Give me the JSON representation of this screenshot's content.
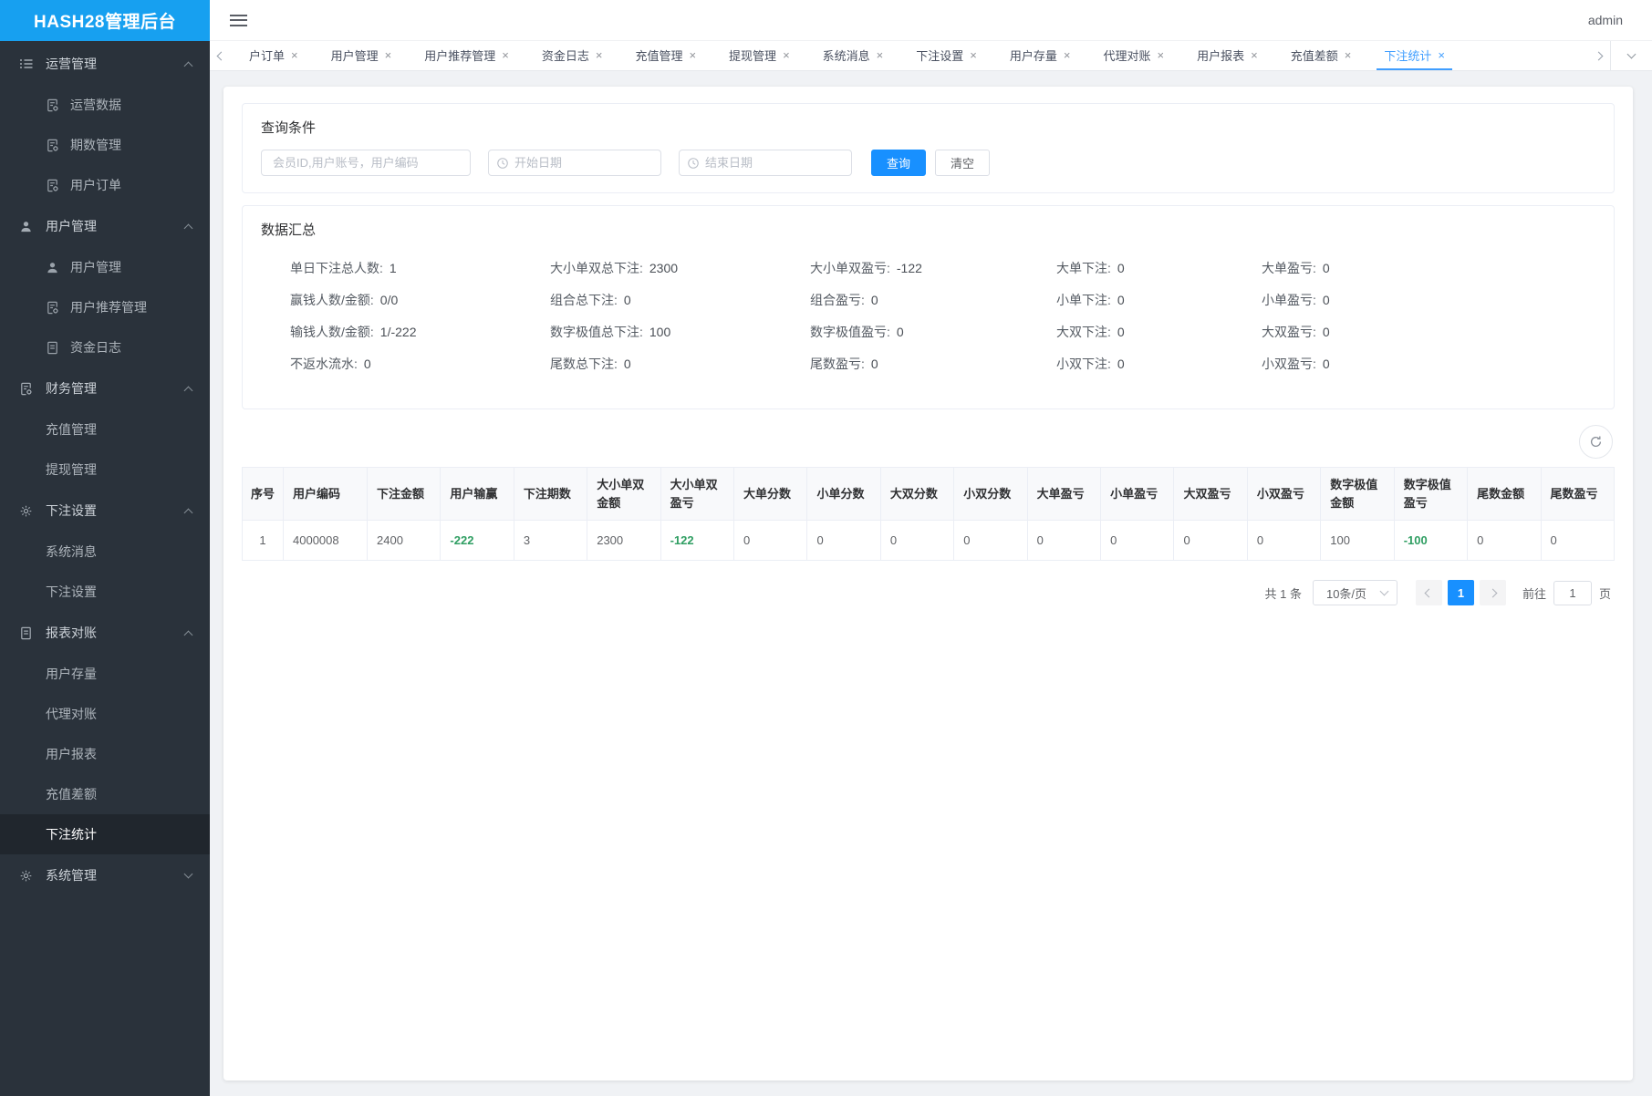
{
  "colors": {
    "brand": "#17a0f0",
    "accent": "#1890ff",
    "tabblue": "#409eff",
    "sidebar": "#2a323b",
    "sidebar_active": "#20262d",
    "green": "#2f9e62",
    "bg": "#f0f2f5"
  },
  "app": {
    "title": "HASH28管理后台",
    "user": "admin"
  },
  "sidebar": {
    "sections": [
      {
        "name": "operations",
        "label": "运营管理",
        "icon": "list-icon",
        "expanded": true,
        "children": [
          {
            "name": "operation-data",
            "label": "运营数据",
            "icon": "doc-gear-icon"
          },
          {
            "name": "period-management",
            "label": "期数管理",
            "icon": "doc-gear-icon"
          },
          {
            "name": "user-orders",
            "label": "用户订单",
            "icon": "doc-gear-icon"
          }
        ]
      },
      {
        "name": "user-management",
        "label": "用户管理",
        "icon": "user-icon",
        "expanded": true,
        "children": [
          {
            "name": "user-management",
            "label": "用户管理",
            "icon": "user-icon"
          },
          {
            "name": "user-referral",
            "label": "用户推荐管理",
            "icon": "doc-gear-icon"
          },
          {
            "name": "fund-logs",
            "label": "资金日志",
            "icon": "doc-icon"
          }
        ]
      },
      {
        "name": "finance",
        "label": "财务管理",
        "icon": "doc-gear-icon",
        "expanded": true,
        "children": [
          {
            "name": "recharge-management",
            "label": "充值管理"
          },
          {
            "name": "withdraw-management",
            "label": "提现管理"
          }
        ]
      },
      {
        "name": "bet-settings",
        "label": "下注设置",
        "icon": "gear-icon",
        "expanded": true,
        "children": [
          {
            "name": "system-messages",
            "label": "系统消息"
          },
          {
            "name": "bet-settings",
            "label": "下注设置"
          }
        ]
      },
      {
        "name": "reports",
        "label": "报表对账",
        "icon": "doc-icon",
        "expanded": true,
        "children": [
          {
            "name": "user-balance",
            "label": "用户存量"
          },
          {
            "name": "agent-reconciliation",
            "label": "代理对账"
          },
          {
            "name": "user-reports",
            "label": "用户报表"
          },
          {
            "name": "recharge-difference",
            "label": "充值差额"
          },
          {
            "name": "bet-statistics",
            "label": "下注统计",
            "active": true
          }
        ]
      },
      {
        "name": "system",
        "label": "系统管理",
        "icon": "gear-icon",
        "expanded": false,
        "children": []
      }
    ]
  },
  "tabs": {
    "items": [
      {
        "name": "user-orders",
        "label": "户订单"
      },
      {
        "name": "user-management",
        "label": "用户管理"
      },
      {
        "name": "user-referral",
        "label": "用户推荐管理"
      },
      {
        "name": "fund-logs",
        "label": "资金日志"
      },
      {
        "name": "recharge-management",
        "label": "充值管理"
      },
      {
        "name": "withdraw-management",
        "label": "提现管理"
      },
      {
        "name": "system-messages",
        "label": "系统消息"
      },
      {
        "name": "bet-settings",
        "label": "下注设置"
      },
      {
        "name": "user-balance",
        "label": "用户存量"
      },
      {
        "name": "agent-reconciliation",
        "label": "代理对账"
      },
      {
        "name": "user-reports",
        "label": "用户报表"
      },
      {
        "name": "recharge-difference",
        "label": "充值差额"
      },
      {
        "name": "bet-statistics",
        "label": "下注统计",
        "active": true
      }
    ]
  },
  "query": {
    "title": "查询条件",
    "keyword_placeholder": "会员ID,用户账号，用户编码",
    "start_placeholder": "开始日期",
    "end_placeholder": "结束日期",
    "search_label": "查询",
    "clear_label": "清空"
  },
  "summary": {
    "title": "数据汇总",
    "rows": [
      [
        {
          "label": "单日下注总人数:",
          "value": "1"
        },
        {
          "label": "大小单双总下注:",
          "value": "2300"
        },
        {
          "label": "大小单双盈亏:",
          "value": "-122"
        },
        {
          "label": "大单下注:",
          "value": "0"
        },
        {
          "label": "大单盈亏:",
          "value": "0"
        }
      ],
      [
        {
          "label": "赢钱人数/金额:",
          "value": "0/0"
        },
        {
          "label": "组合总下注:",
          "value": "0"
        },
        {
          "label": "组合盈亏:",
          "value": "0"
        },
        {
          "label": "小单下注:",
          "value": "0"
        },
        {
          "label": "小单盈亏:",
          "value": "0"
        }
      ],
      [
        {
          "label": "输钱人数/金额:",
          "value": "1/-222"
        },
        {
          "label": "数字极值总下注:",
          "value": "100"
        },
        {
          "label": "数字极值盈亏:",
          "value": "0"
        },
        {
          "label": "大双下注:",
          "value": "0"
        },
        {
          "label": "大双盈亏:",
          "value": "0"
        }
      ],
      [
        {
          "label": "不返水流水:",
          "value": "0"
        },
        {
          "label": "尾数总下注:",
          "value": "0"
        },
        {
          "label": "尾数盈亏:",
          "value": "0"
        },
        {
          "label": "小双下注:",
          "value": "0"
        },
        {
          "label": "小双盈亏:",
          "value": "0"
        }
      ]
    ]
  },
  "table": {
    "columns": [
      {
        "name": "seq",
        "label": "序号"
      },
      {
        "name": "user-code",
        "label": "用户编码"
      },
      {
        "name": "bet-amount",
        "label": "下注金额"
      },
      {
        "name": "user-winloss",
        "label": "用户输赢"
      },
      {
        "name": "bet-periods",
        "label": "下注期数"
      },
      {
        "name": "bigsmall-amount",
        "label": "大小单双金额"
      },
      {
        "name": "bigsmall-pl",
        "label": "大小单双盈亏"
      },
      {
        "name": "big-odd-score",
        "label": "大单分数"
      },
      {
        "name": "small-odd-score",
        "label": "小单分数"
      },
      {
        "name": "big-even-score",
        "label": "大双分数"
      },
      {
        "name": "small-even-score",
        "label": "小双分数"
      },
      {
        "name": "big-odd-pl",
        "label": "大单盈亏"
      },
      {
        "name": "small-odd-pl",
        "label": "小单盈亏"
      },
      {
        "name": "big-even-pl",
        "label": "大双盈亏"
      },
      {
        "name": "small-even-pl",
        "label": "小双盈亏"
      },
      {
        "name": "extreme-amount",
        "label": "数字极值金额"
      },
      {
        "name": "extreme-pl",
        "label": "数字极值盈亏"
      },
      {
        "name": "tail-amount",
        "label": "尾数金额"
      },
      {
        "name": "tail-pl",
        "label": "尾数盈亏"
      }
    ],
    "rows": [
      [
        "1",
        "4000008",
        "2400",
        "-222",
        "3",
        "2300",
        "-122",
        "0",
        "0",
        "0",
        "0",
        "0",
        "0",
        "0",
        "0",
        "100",
        "-100",
        "0",
        "0"
      ]
    ]
  },
  "pagination": {
    "total": "共 1 条",
    "page_size": "10条/页",
    "current_page": "1",
    "goto_label": "前往",
    "goto_value": "1",
    "page_label": "页"
  }
}
